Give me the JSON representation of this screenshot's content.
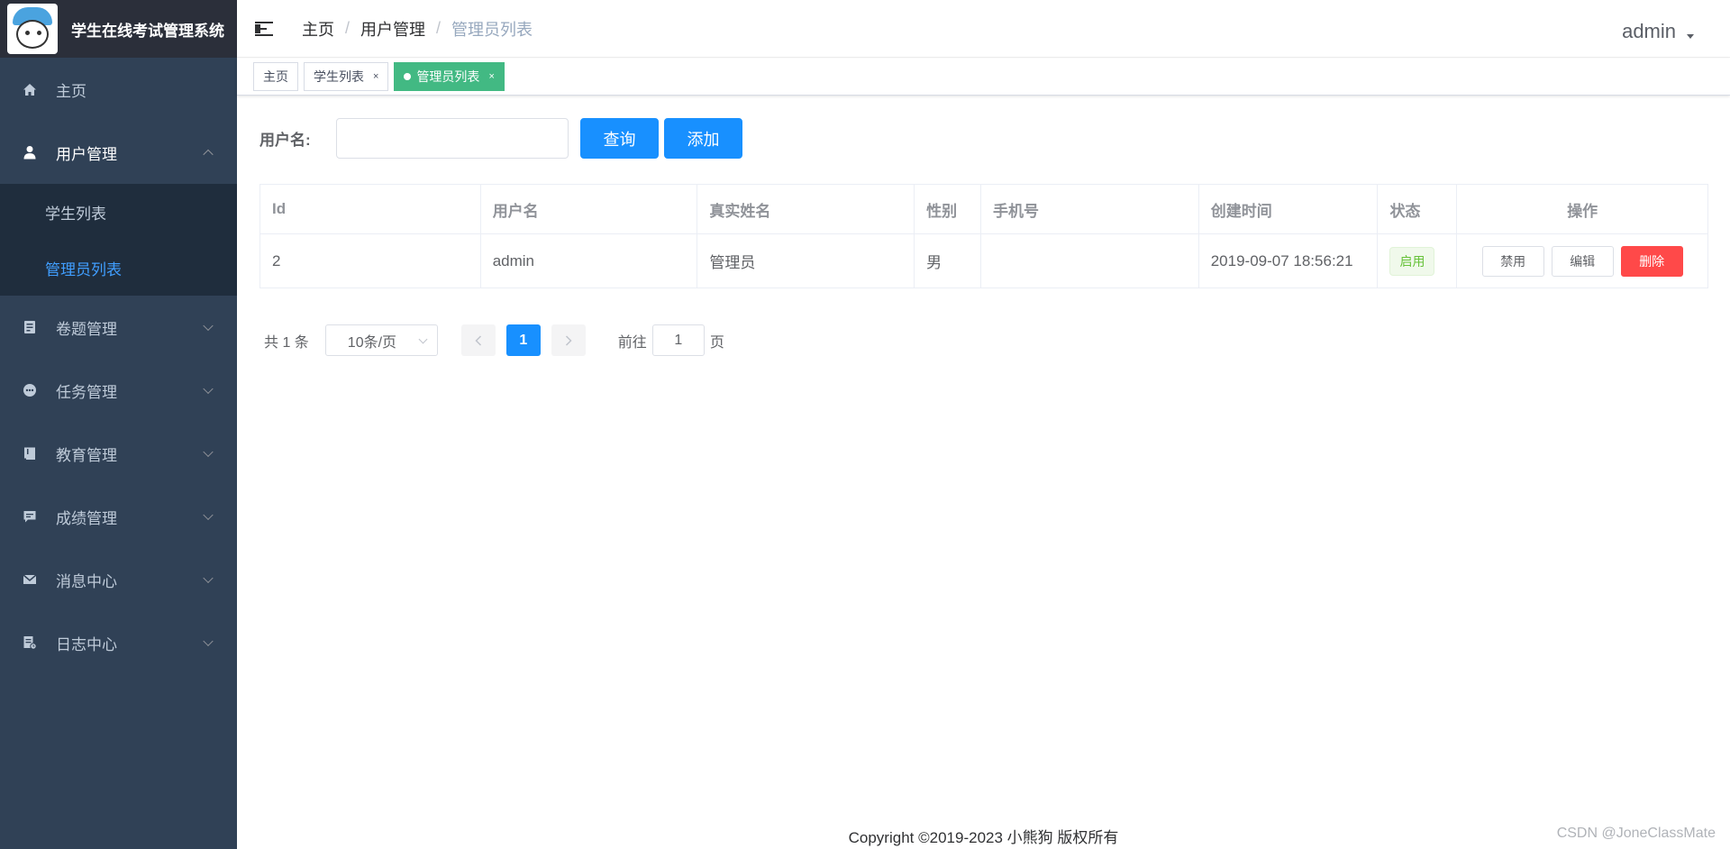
{
  "app": {
    "title": "学生在线考试管理系统"
  },
  "sidebar": {
    "items": [
      {
        "label": "主页",
        "icon": "home-icon"
      },
      {
        "label": "用户管理",
        "icon": "user-icon",
        "open": true,
        "children": [
          {
            "label": "学生列表"
          },
          {
            "label": "管理员列表",
            "active": true
          }
        ]
      },
      {
        "label": "卷题管理",
        "icon": "exam-icon"
      },
      {
        "label": "任务管理",
        "icon": "task-icon"
      },
      {
        "label": "教育管理",
        "icon": "book-icon"
      },
      {
        "label": "成绩管理",
        "icon": "chat-icon"
      },
      {
        "label": "消息中心",
        "icon": "mail-icon"
      },
      {
        "label": "日志中心",
        "icon": "log-icon"
      }
    ]
  },
  "header": {
    "breadcrumb": [
      "主页",
      "用户管理",
      "管理员列表"
    ],
    "separator": "/",
    "user": "admin"
  },
  "tags": [
    {
      "label": "主页",
      "closable": false
    },
    {
      "label": "学生列表",
      "closable": true
    },
    {
      "label": "管理员列表",
      "closable": true,
      "active": true
    }
  ],
  "tag_close": "×",
  "search": {
    "label": "用户名:",
    "value": "",
    "placeholder": "",
    "query_button": "查询",
    "add_button": "添加"
  },
  "table": {
    "columns": [
      "Id",
      "用户名",
      "真实姓名",
      "性别",
      "手机号",
      "创建时间",
      "状态",
      "操作"
    ],
    "rows": [
      {
        "id": "2",
        "username": "admin",
        "realname": "管理员",
        "sex": "男",
        "phone": "",
        "created": "2019-09-07 18:56:21",
        "status": "启用",
        "actions": [
          "禁用",
          "编辑",
          "删除"
        ]
      }
    ]
  },
  "pagination": {
    "total": "共 1 条",
    "page_size": "10条/页",
    "current": "1",
    "goto_prefix": "前往",
    "goto_value": "1",
    "goto_suffix": "页"
  },
  "footer": "Copyright ©2019-2023 小熊狗 版权所有",
  "watermark": "CSDN @JoneClassMate",
  "colors": {
    "sidebar": "#304156",
    "primary": "#1890ff",
    "active_tag": "#42b983",
    "danger": "#ff4949"
  }
}
